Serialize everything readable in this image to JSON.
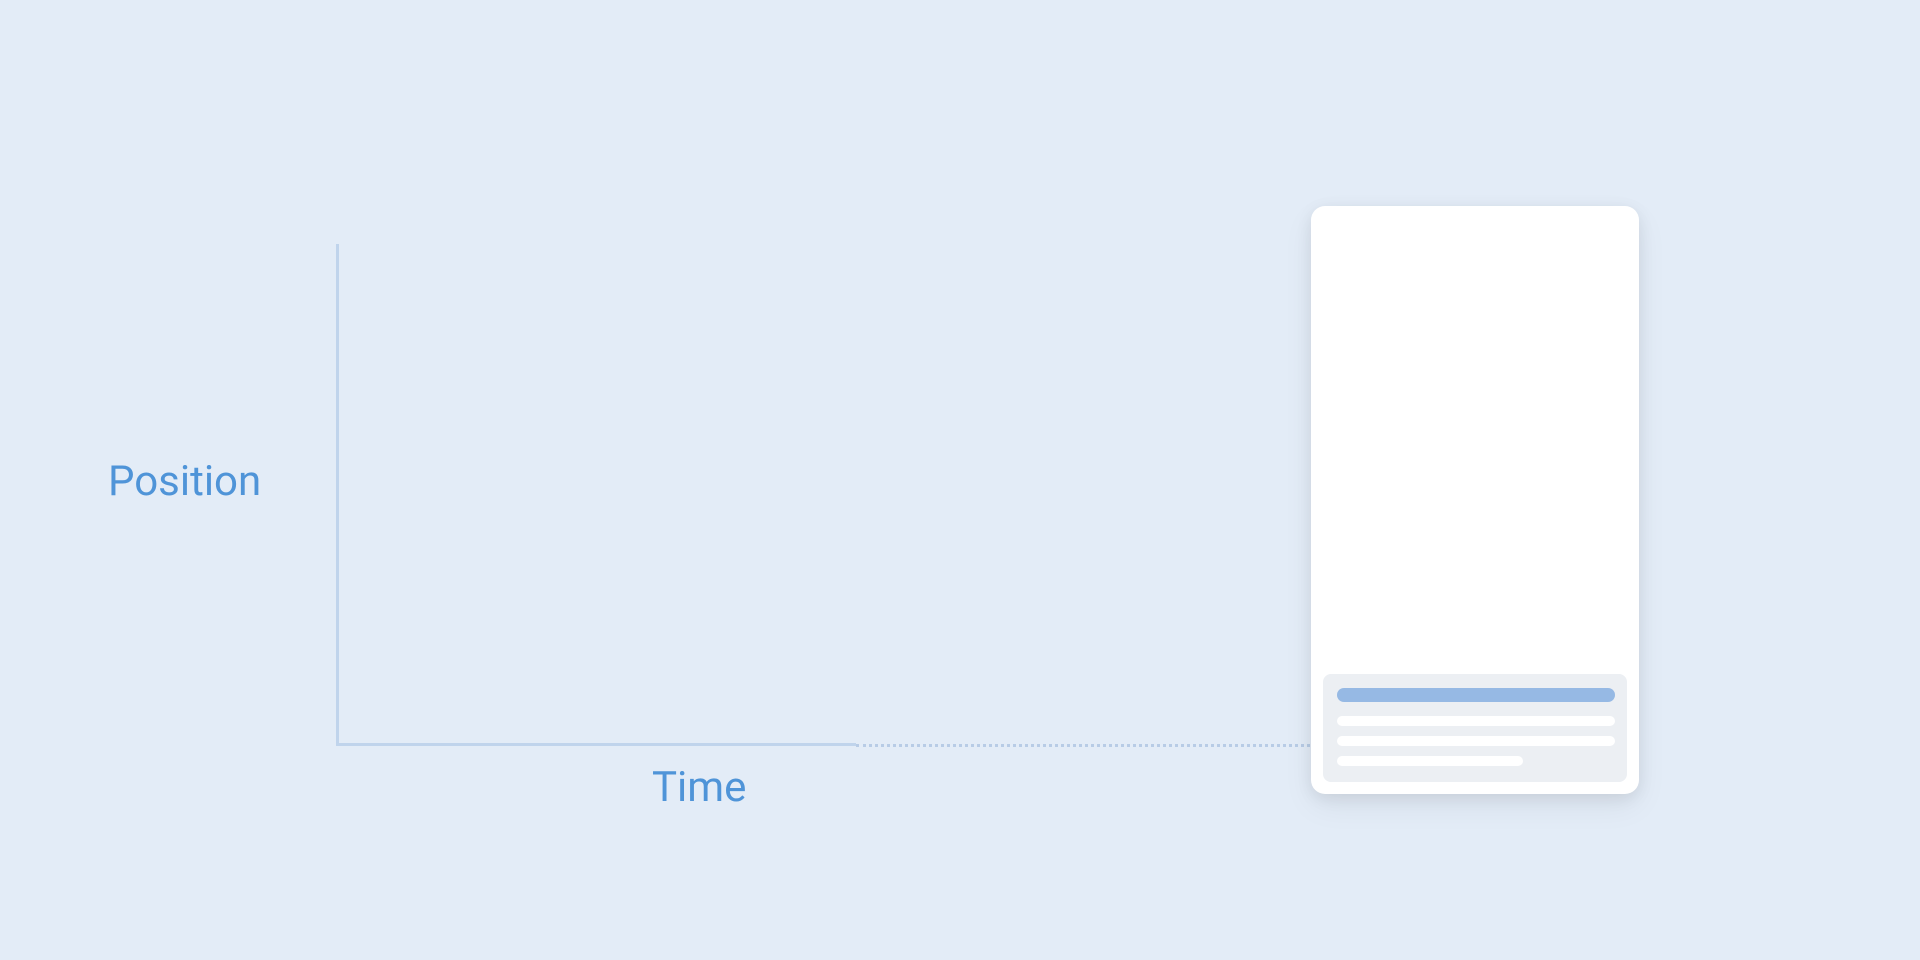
{
  "chart": {
    "y_label": "Position",
    "x_label": "Time"
  },
  "chart_data": {
    "type": "line",
    "title": "",
    "xlabel": "Time",
    "ylabel": "Position",
    "series": [],
    "note": "Empty position-over-time axes with a dotted guide line extending to a phone mockup; no plotted data values are visible."
  }
}
